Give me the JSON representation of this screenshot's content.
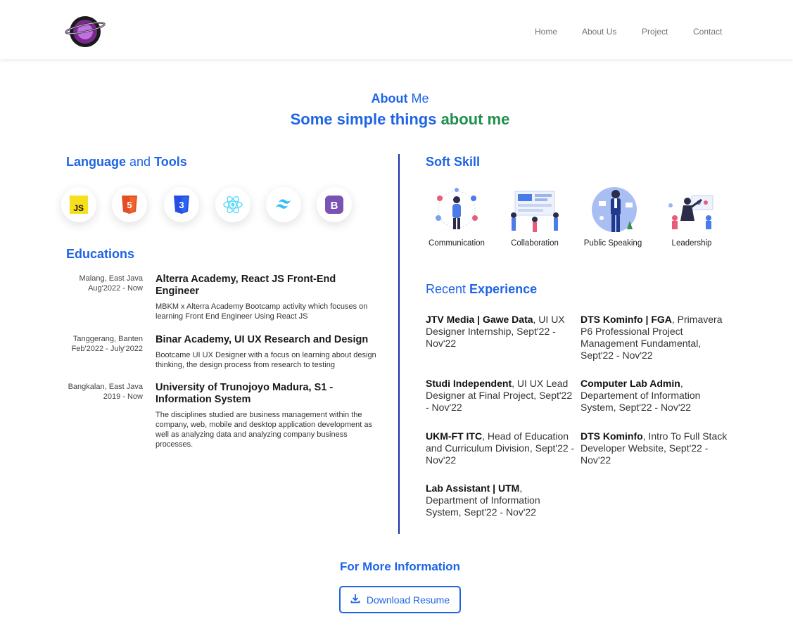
{
  "nav": {
    "items": [
      "Home",
      "About Us",
      "Project",
      "Contact"
    ]
  },
  "about": {
    "title_bold": "About",
    "title_rest": " Me",
    "subtitle_blue": "Some simple things ",
    "subtitle_green": "about me"
  },
  "tools": {
    "heading_a": "Language",
    "heading_and": " and ",
    "heading_b": "Tools",
    "items": [
      {
        "icon": "javascript-icon",
        "text": "JS",
        "color": "#f7df1e"
      },
      {
        "icon": "html5-icon",
        "text": "5",
        "color": "#e44d26"
      },
      {
        "icon": "css3-icon",
        "text": "3",
        "color": "#264de4"
      },
      {
        "icon": "react-icon",
        "color": "#61dafb"
      },
      {
        "icon": "tailwind-icon",
        "color": "#38bdf8"
      },
      {
        "icon": "bootstrap-icon",
        "text": "B",
        "color": "#7952b3"
      }
    ]
  },
  "educations": {
    "heading": "Educations",
    "items": [
      {
        "place": "Malang, East Java",
        "period": "Aug'2022 - Now",
        "title": "Alterra Academy, React JS Front-End Engineer",
        "desc": "MBKM x Alterra Academy Bootcamp activity which focuses on learning Front End Engineer Using React JS"
      },
      {
        "place": "Tanggerang, Banten",
        "period": "Feb'2022 - July'2022",
        "title": "Binar Academy, UI UX Research and Design",
        "desc": "Bootcame UI UX Designer with a focus on learning about design thinking, the design process from research to testing"
      },
      {
        "place": "Bangkalan, East Java",
        "period": "2019 - Now",
        "title": "University of Trunojoyo Madura, S1 - Information System",
        "desc": "The disciplines studied are business management within the company, web, mobile and desktop application development as well as analyzing data and analyzing company business processes."
      }
    ]
  },
  "soft_skill": {
    "heading": "Soft Skill",
    "items": [
      "Communication",
      "Collaboration",
      "Public Speaking",
      "Leadership"
    ]
  },
  "experience": {
    "heading_light": "Recent ",
    "heading_bold": "Experience",
    "items": [
      {
        "bold": "JTV Media | Gawe Data",
        "rest": ", UI UX Designer Internship, Sept'22 - Nov'22"
      },
      {
        "bold": "DTS Kominfo | FGA",
        "rest": ", Primavera P6 Professional Project Management Fundamental, Sept'22 - Nov'22"
      },
      {
        "bold": "Studi Independent",
        "rest": ", UI UX Lead Designer at Final Project, Sept'22 - Nov'22"
      },
      {
        "bold": "Computer Lab Admin",
        "rest": ", Departement of Information System, Sept'22 - Nov'22"
      },
      {
        "bold": "UKM-FT ITC",
        "rest": ", Head of Education and Curriculum Division, Sept'22 - Nov'22"
      },
      {
        "bold": "DTS Kominfo",
        "rest": ", Intro To Full Stack Developer Website, Sept'22 - Nov'22"
      },
      {
        "bold": "Lab Assistant | UTM",
        "rest": ", Department of Information System, Sept'22 - Nov'22"
      }
    ]
  },
  "more": {
    "heading": "For More Information",
    "button_label": "Download Resume"
  }
}
